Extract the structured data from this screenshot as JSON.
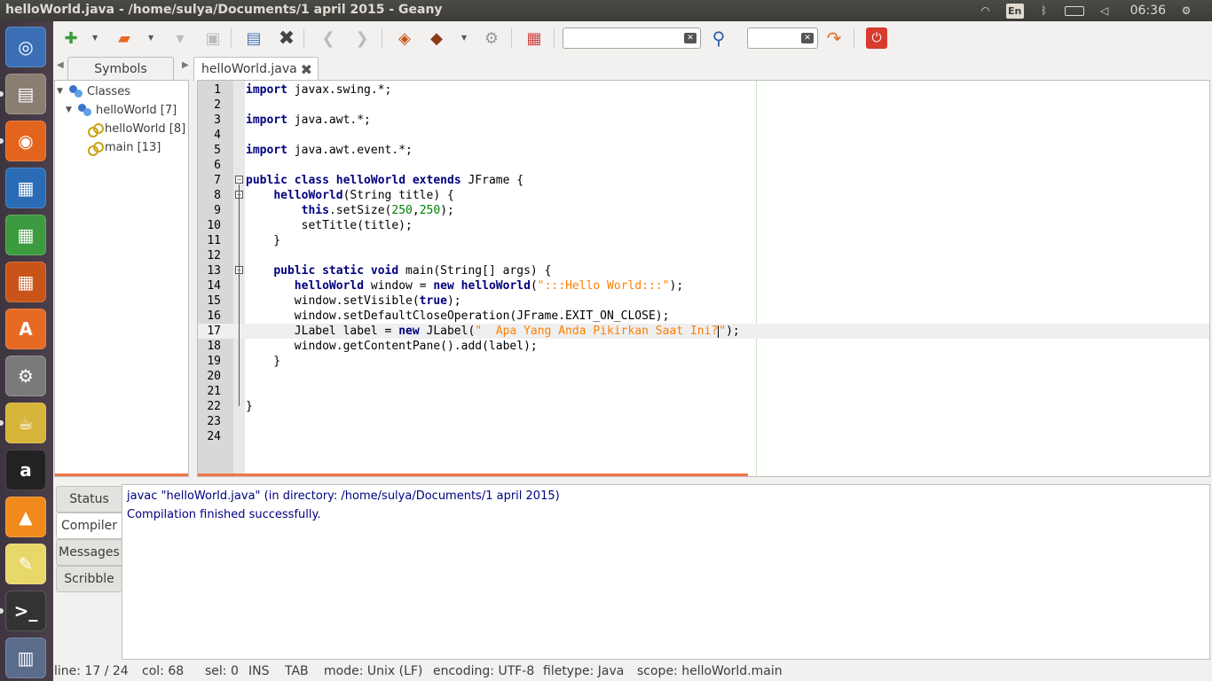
{
  "window": {
    "title": "helloWorld.java - /home/sulya/Documents/1 april 2015 - Geany"
  },
  "indicators": {
    "keyboard": "En",
    "clock": "06:36"
  },
  "launcher": [
    {
      "name": "ubuntu-dash-icon",
      "glyph": "◎",
      "color": "#3b6fb5"
    },
    {
      "name": "files-icon",
      "glyph": "▤",
      "color": "#8a7e72"
    },
    {
      "name": "firefox-icon",
      "glyph": "◉",
      "color": "#e2641d"
    },
    {
      "name": "writer-icon",
      "glyph": "▦",
      "color": "#2a6bb6"
    },
    {
      "name": "calc-icon",
      "glyph": "▦",
      "color": "#3c9a3f"
    },
    {
      "name": "impress-icon",
      "glyph": "▦",
      "color": "#c9541a"
    },
    {
      "name": "software-center-icon",
      "glyph": "A",
      "color": "#e66a23"
    },
    {
      "name": "system-settings-icon",
      "glyph": "⚙",
      "color": "#7a7a7a"
    },
    {
      "name": "geany-icon",
      "glyph": "☕",
      "color": "#d7b43a"
    },
    {
      "name": "amazon-icon",
      "glyph": "a",
      "color": "#222222"
    },
    {
      "name": "vlc-icon",
      "glyph": "▲",
      "color": "#f08a1c"
    },
    {
      "name": "notes-icon",
      "glyph": "✎",
      "color": "#e8d86a"
    },
    {
      "name": "terminal-icon",
      "glyph": ">_",
      "color": "#333333"
    },
    {
      "name": "trash-icon",
      "glyph": "▥",
      "color": "#5a6c8a"
    }
  ],
  "sidebar": {
    "tab": "Symbols",
    "tree": [
      {
        "label": "Classes",
        "level": 0,
        "icon": "class"
      },
      {
        "label": "helloWorld [7]",
        "level": 1,
        "icon": "class"
      },
      {
        "label": "helloWorld [8]",
        "level": 2,
        "icon": "method"
      },
      {
        "label": "main [13]",
        "level": 2,
        "icon": "method"
      }
    ]
  },
  "editor": {
    "tab": "helloWorld.java",
    "current_line": 17
  },
  "messages": {
    "tabs": [
      "Status",
      "Compiler",
      "Messages",
      "Scribble"
    ],
    "active": "Compiler",
    "lines": [
      "javac \"helloWorld.java\" (in directory: /home/sulya/Documents/1 april 2015)",
      "Compilation finished successfully."
    ]
  },
  "status": {
    "line": "line: 17 / 24",
    "col": "col: 68",
    "sel": "sel: 0",
    "ins": "INS",
    "tab": "TAB",
    "mode": "mode: Unix (LF)",
    "encoding": "encoding: UTF-8",
    "filetype": "filetype: Java",
    "scope": "scope: helloWorld.main"
  }
}
